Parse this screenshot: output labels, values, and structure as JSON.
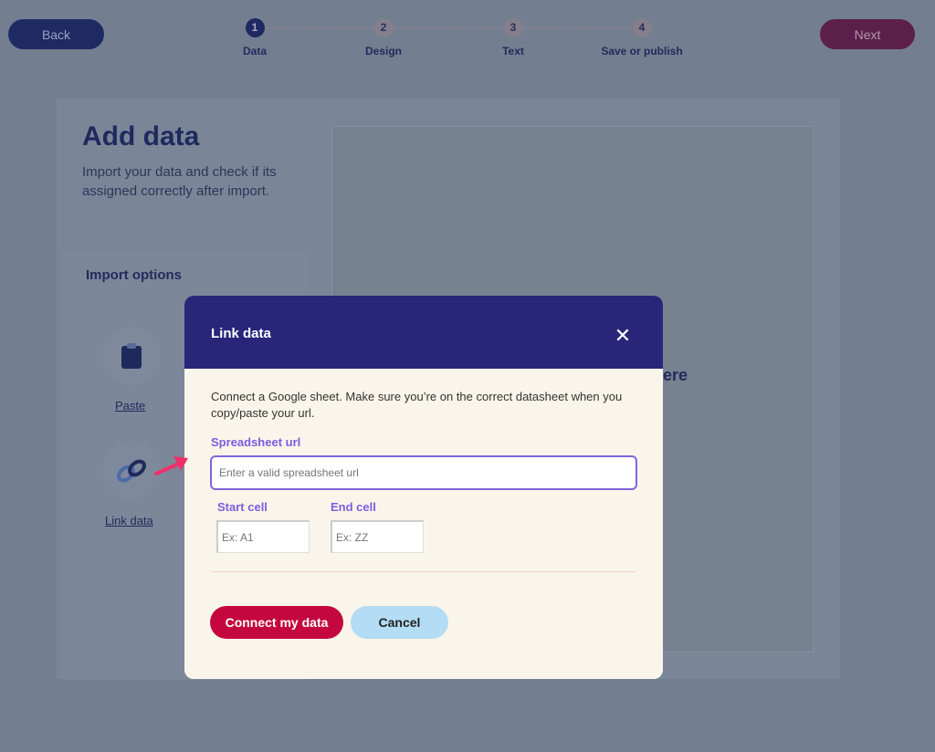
{
  "nav": {
    "back": "Back",
    "next": "Next",
    "steps": [
      {
        "num": "1",
        "label": "Data"
      },
      {
        "num": "2",
        "label": "Design"
      },
      {
        "num": "3",
        "label": "Text"
      },
      {
        "num": "4",
        "label": "Save or publish"
      }
    ]
  },
  "page": {
    "title": "Add data",
    "subtitle": "Import your data and check if its assigned correctly after import.",
    "import_title": "Import options",
    "options": [
      {
        "label": "Paste",
        "icon": "clipboard-icon"
      },
      {
        "label": "Link data",
        "icon": "link-icon"
      }
    ],
    "drop_text_fragment": "ere"
  },
  "modal": {
    "title": "Link data",
    "description": "Connect a Google sheet. Make sure you’re on the correct datasheet when you copy/paste your url.",
    "url_label": "Spreadsheet url",
    "url_placeholder": "Enter a valid spreadsheet url",
    "start_label": "Start cell",
    "start_placeholder": "Ex: A1",
    "end_label": "End cell",
    "end_placeholder": "Ex: ZZ",
    "connect": "Connect my data",
    "cancel": "Cancel"
  },
  "colors": {
    "header": "#29267a",
    "primary": "#c4073f",
    "accent": "#7c5ce0",
    "annotation_arrow": "#f0306a"
  }
}
